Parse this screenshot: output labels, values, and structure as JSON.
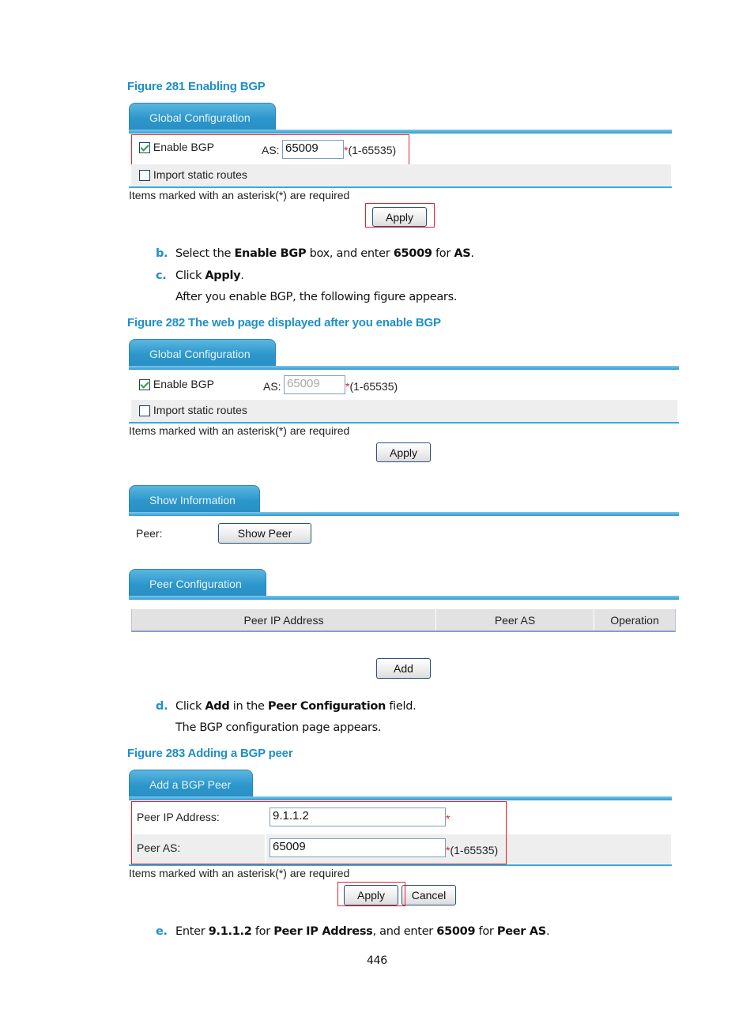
{
  "figures": {
    "fig281": {
      "caption": "Figure 281 Enabling BGP",
      "tab": "Global Configuration",
      "enable_bgp_label": "Enable BGP",
      "enable_bgp_checked": true,
      "as_label": "AS:",
      "as_value": "65009",
      "as_required": "*",
      "as_range": "(1-65535)",
      "import_label": "Import static routes",
      "import_checked": false,
      "required_note": "Items marked with an asterisk(*) are required",
      "apply": "Apply"
    },
    "fig282": {
      "caption": "Figure 282 The web page displayed after you enable BGP",
      "global": {
        "tab": "Global Configuration",
        "enable_bgp_label": "Enable BGP",
        "enable_bgp_checked": true,
        "as_label": "AS:",
        "as_value": "65009",
        "as_required": "*",
        "as_range": "(1-65535)",
        "import_label": "Import static routes",
        "import_checked": false,
        "required_note": "Items marked with an asterisk(*) are required",
        "apply": "Apply"
      },
      "show_info": {
        "tab": "Show Information",
        "peer_label": "Peer:",
        "show_peer": "Show Peer"
      },
      "peer_config": {
        "tab": "Peer Configuration",
        "columns": [
          "Peer IP Address",
          "Peer AS",
          "Operation"
        ],
        "add": "Add"
      }
    },
    "fig283": {
      "caption": "Figure 283 Adding a BGP peer",
      "tab": "Add a BGP Peer",
      "peer_ip_label": "Peer IP Address:",
      "peer_ip_value": "9.1.1.2",
      "peer_ip_required": "*",
      "peer_as_label": "Peer AS:",
      "peer_as_value": "65009",
      "peer_as_required": "*",
      "peer_as_range": "(1-65535)",
      "required_note": "Items marked with an asterisk(*) are required",
      "apply": "Apply",
      "cancel": "Cancel"
    }
  },
  "steps": {
    "b": {
      "label": "b.",
      "t1": "Select the ",
      "b1": "Enable BGP",
      "t2": " box, and enter ",
      "b2": "65009",
      "t3": " for ",
      "b3": "AS",
      "t4": "."
    },
    "c": {
      "label": "c.",
      "t1": "Click ",
      "b1": "Apply",
      "t2": "."
    },
    "c_note": "After you enable BGP, the following figure appears.",
    "d": {
      "label": "d.",
      "t1": "Click ",
      "b1": "Add",
      "t2": " in the ",
      "b2": "Peer Configuration",
      "t3": " field."
    },
    "d_note": "The BGP configuration page appears.",
    "e": {
      "label": "e.",
      "t1": "Enter ",
      "b1": "9.1.1.2",
      "t2": " for ",
      "b2": "Peer IP Address",
      "t3": ", and enter ",
      "b3": "65009",
      "t4": " for ",
      "b4": "Peer AS",
      "t5": "."
    }
  },
  "page_number": "446"
}
